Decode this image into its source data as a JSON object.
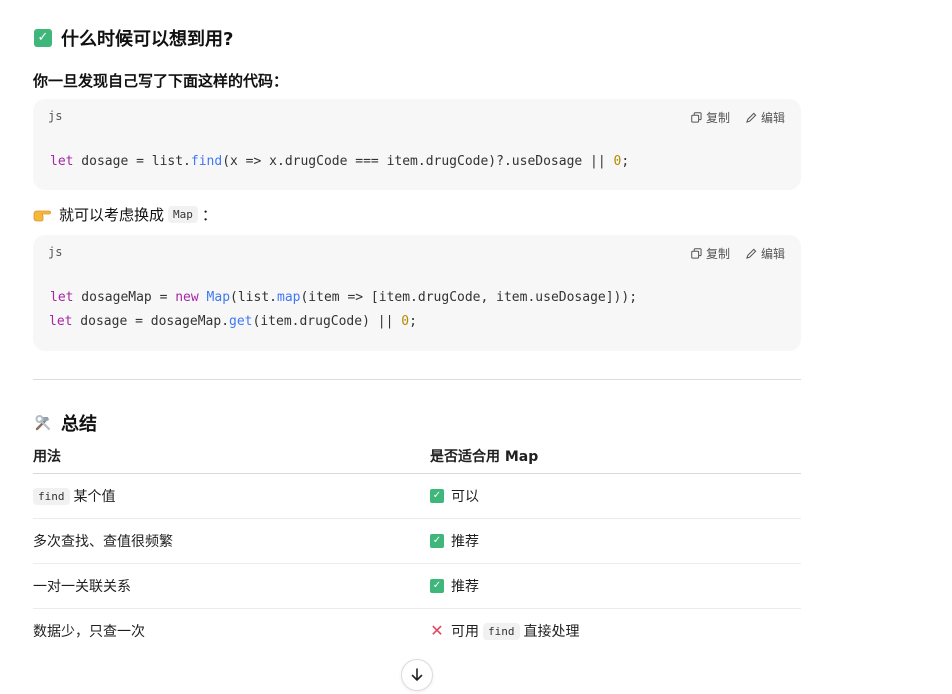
{
  "section1": {
    "title": "什么时候可以想到用?"
  },
  "intro_text": "你一旦发现自己写了下面这样的代码：",
  "code1": {
    "lang": "js",
    "copy_label": "复制",
    "edit_label": "编辑",
    "line1": {
      "kw_let": "let",
      "t1": " dosage = list.",
      "fn_find": "find",
      "t2": "(x => x.drugCode === item.drugCode)?.useDosage || ",
      "num_0": "0",
      "t3": ";"
    }
  },
  "hint": {
    "prefix": "就可以考虑换成",
    "code": "Map",
    "suffix": "："
  },
  "code2": {
    "lang": "js",
    "copy_label": "复制",
    "edit_label": "编辑",
    "line1": {
      "kw_let": "let",
      "t1": " dosageMap = ",
      "kw_new": "new",
      "t2": " ",
      "fn_Map": "Map",
      "t3": "(list.",
      "fn_map": "map",
      "t4": "(item => [item.drugCode, item.useDosage]));"
    },
    "line2": {
      "kw_let": "let",
      "t1": " dosage = dosageMap.",
      "fn_get": "get",
      "t2": "(item.drugCode) || ",
      "num_0": "0",
      "t3": ";"
    }
  },
  "section2": {
    "title": "总结"
  },
  "table": {
    "headers": [
      "用法",
      "是否适合用 Map"
    ],
    "rows": [
      {
        "c1_code": "find",
        "c1_text": "某个值",
        "c2_icon": "check",
        "c2_text": "可以"
      },
      {
        "c1_text": "多次查找、查值很频繁",
        "c2_icon": "check",
        "c2_text": "推荐"
      },
      {
        "c1_text": "一对一关联关系",
        "c2_icon": "check",
        "c2_text": "推荐"
      },
      {
        "c1_text": "数据少，只查一次",
        "c2_icon": "cross",
        "c2_text_pre": "可用",
        "c2_code": "find",
        "c2_text_post": "直接处理"
      }
    ]
  },
  "colors": {
    "check": "#3fb77a",
    "cross": "#e2445c",
    "keyword": "#a626a4",
    "function": "#4078f2",
    "number": "#b58900"
  }
}
